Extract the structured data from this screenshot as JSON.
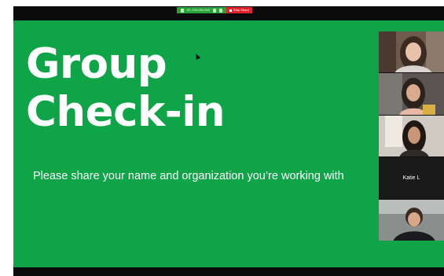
{
  "meeting": {
    "share_bar": {
      "meeting_id": "ID: 239-090-940",
      "stop_share_label": "Stop Share"
    }
  },
  "slide": {
    "title_line1": "Group",
    "title_line2": "Check-in",
    "subtitle": "Please share your name and organization you’re working with",
    "background_color": "#0fa447",
    "text_color": "#ffffff"
  },
  "gallery": {
    "participants": [
      {
        "kind": "video"
      },
      {
        "kind": "video"
      },
      {
        "kind": "video"
      },
      {
        "kind": "name",
        "name": "Katie L"
      },
      {
        "kind": "video"
      }
    ]
  },
  "colors": {
    "share_green": "#2aa43a",
    "stop_red": "#e0242a",
    "chrome_black": "#0b0b0b"
  }
}
